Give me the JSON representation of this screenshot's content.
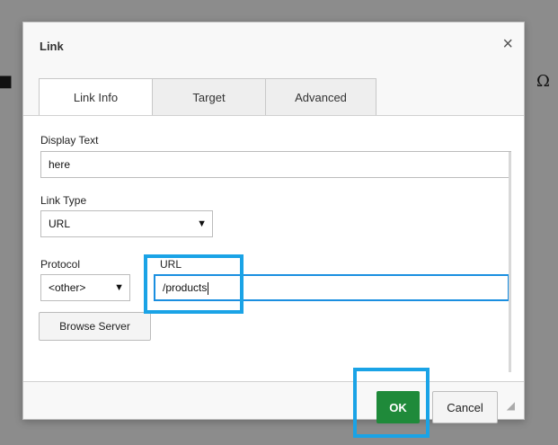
{
  "editor": {
    "left_glyph": "■",
    "right_glyph": "Ω"
  },
  "dialog": {
    "title": "Link",
    "close_glyph": "×",
    "tabs": [
      {
        "label": "Link Info",
        "active": true
      },
      {
        "label": "Target",
        "active": false
      },
      {
        "label": "Advanced",
        "active": false
      }
    ],
    "fields": {
      "display_text_label": "Display Text",
      "display_text_value": "here",
      "link_type_label": "Link Type",
      "link_type_value": "URL",
      "protocol_label": "Protocol",
      "protocol_value": "<other>",
      "url_label": "URL",
      "url_value": "/products"
    },
    "browse_button": "Browse Server",
    "ok_button": "OK",
    "cancel_button": "Cancel",
    "arrow_glyph": "▼"
  },
  "highlight_color": "#1aa3e6",
  "ok_color": "#1f8a3a"
}
